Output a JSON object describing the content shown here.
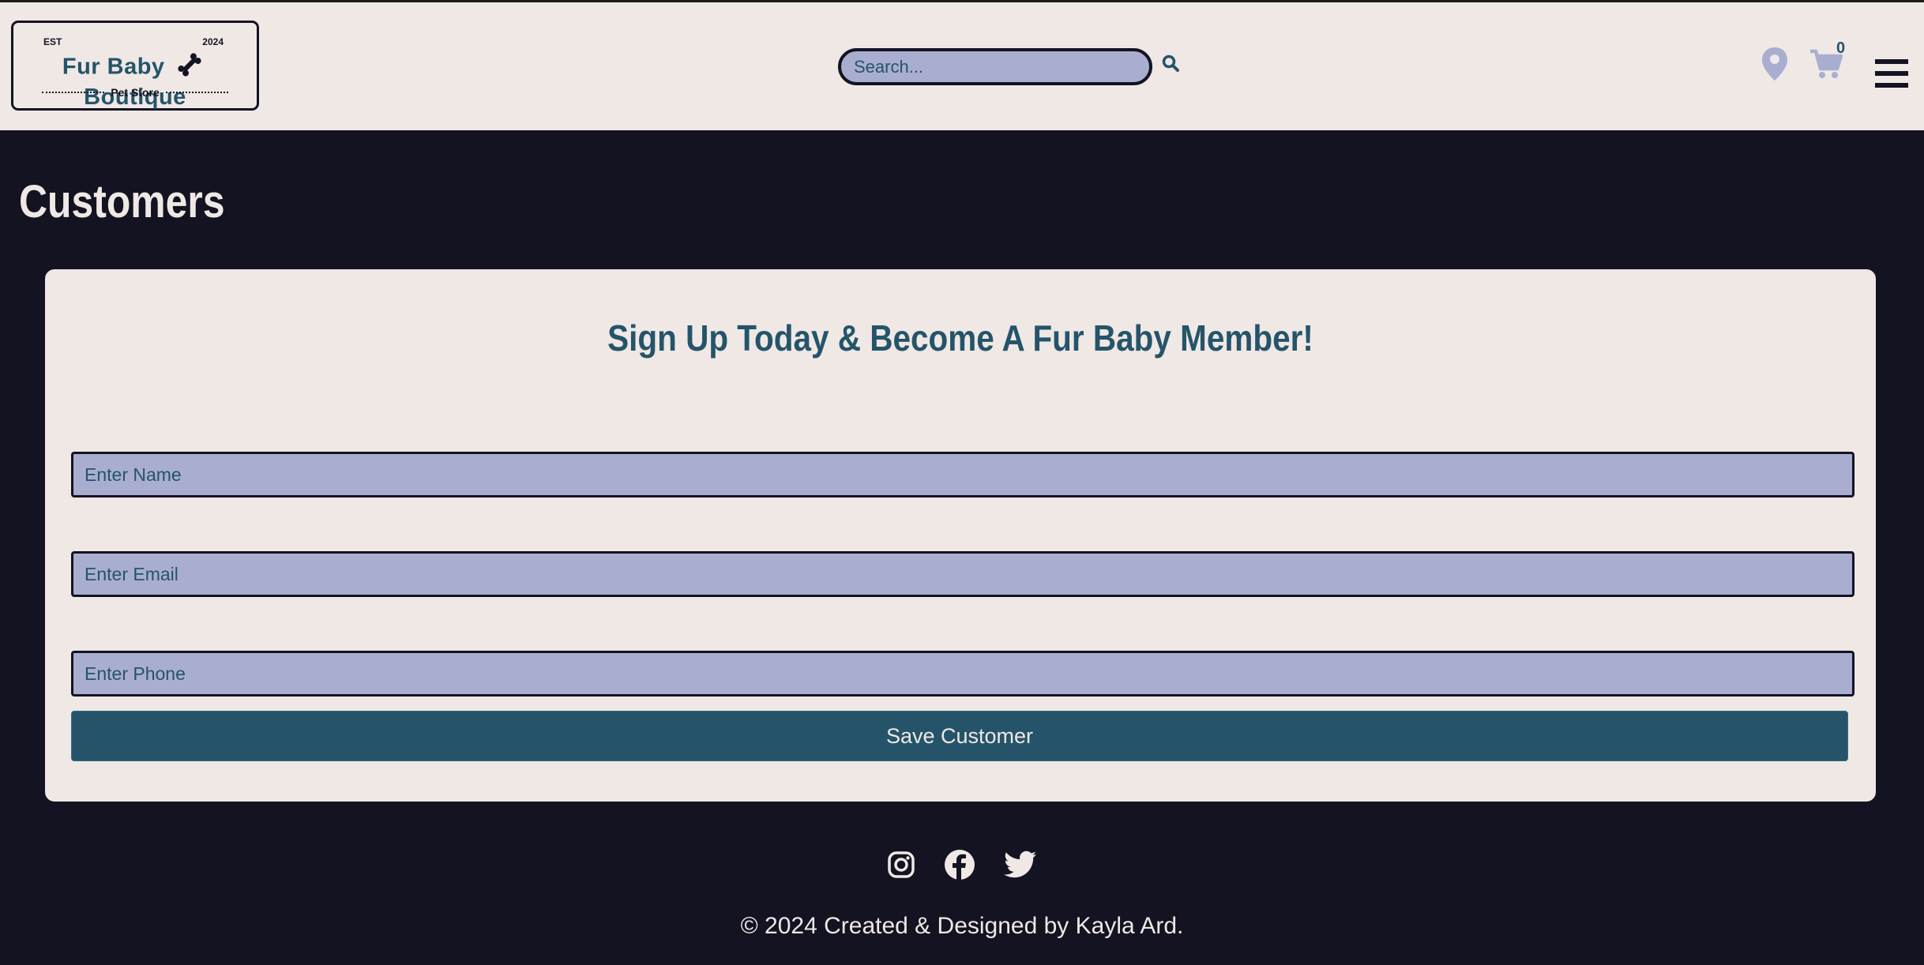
{
  "header": {
    "logo": {
      "est": "EST",
      "year": "2024",
      "name_left": "Fur Baby",
      "name_right": "Boutique",
      "subtitle": "Pet Store"
    },
    "search": {
      "placeholder": "Search..."
    },
    "cart_count": "0"
  },
  "main": {
    "title": "Customers",
    "form": {
      "heading": "Sign Up Today & Become A Fur Baby Member!",
      "name_placeholder": "Enter Name",
      "email_placeholder": "Enter Email",
      "phone_placeholder": "Enter Phone",
      "submit_label": "Save Customer"
    }
  },
  "footer": {
    "social": [
      "instagram-icon",
      "facebook-icon",
      "twitter-icon"
    ],
    "copyright": "© 2024 Created & Designed by Kayla Ard."
  },
  "colors": {
    "page_bg": "#131322",
    "header_bg": "#efe8e5",
    "accent": "#25546a",
    "input_bg": "#a9aed1"
  }
}
